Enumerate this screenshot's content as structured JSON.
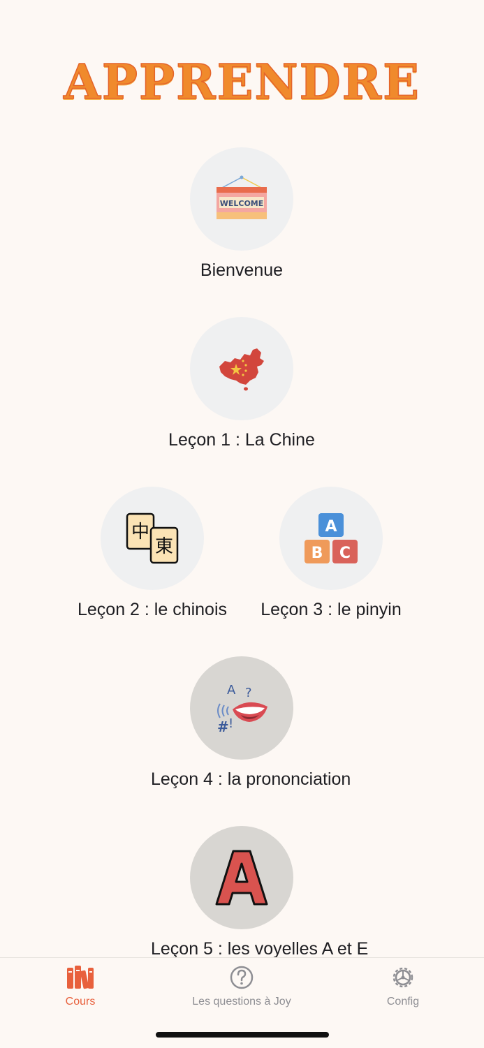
{
  "header": {
    "title": "APPRENDRE"
  },
  "lessons": [
    {
      "label": "Bienvenue",
      "icon": "welcome-sign-icon"
    },
    {
      "label": "Leçon 1 : La Chine",
      "icon": "china-map-icon"
    },
    {
      "label": "Leçon 2 : le chinois",
      "icon": "mahjong-tiles-icon"
    },
    {
      "label": "Leçon 3 : le pinyin",
      "icon": "abc-blocks-icon"
    },
    {
      "label": "Leçon 4 : la prononciation",
      "icon": "speaking-mouth-icon"
    },
    {
      "label": "Leçon 5 : les voyelles A et E",
      "icon": "letter-a-icon"
    }
  ],
  "tabbar": {
    "items": [
      {
        "label": "Cours",
        "icon": "books-icon",
        "active": true
      },
      {
        "label": "Les questions à Joy",
        "icon": "question-circle-icon",
        "active": false
      },
      {
        "label": "Config",
        "icon": "gear-icon",
        "active": false
      }
    ],
    "active_color": "#e8603c",
    "inactive_color": "#8e8e93"
  }
}
